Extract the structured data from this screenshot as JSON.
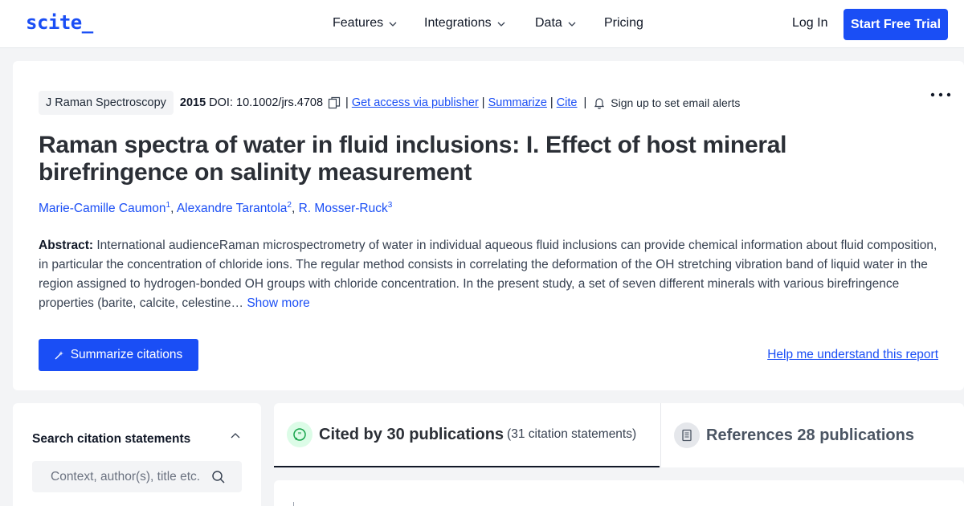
{
  "header": {
    "logo": "scite_",
    "nav": [
      {
        "label": "Features",
        "has_dropdown": true
      },
      {
        "label": "Integrations",
        "has_dropdown": true
      },
      {
        "label": "Data",
        "has_dropdown": true
      },
      {
        "label": "Pricing",
        "has_dropdown": false
      }
    ],
    "login_label": "Log In",
    "trial_label": "Start Free Trial"
  },
  "paper": {
    "journal": "J Raman Spectroscopy",
    "year": "2015",
    "doi": "DOI: 10.1002/jrs.4708",
    "links": {
      "access": "Get access via publisher",
      "summarize": "Summarize",
      "cite": "Cite"
    },
    "separator": "|",
    "alerts_label": "Sign up to set email alerts",
    "title": "Raman spectra of water in fluid inclusions: I. Effect of host mineral birefringence on salinity measurement",
    "authors": [
      {
        "name": "Marie-Camille Caumon",
        "affiliation": "1"
      },
      {
        "name": "Alexandre Tarantola",
        "affiliation": "2"
      },
      {
        "name": "R. Mosser-Ruck",
        "affiliation": "3"
      }
    ],
    "abstract_label": "Abstract:",
    "abstract_text": "International audienceRaman microspectrometry of water in individual aqueous fluid inclusions can provide chemical information about fluid composition, in particular the concentration of chloride ions. The regular method consists in correlating the deformation of the OH stretching vibration band of liquid water in the region assigned to hydrogen-bonded OH groups with chloride concentration. In the present study, a set of seven different minerals with various birefringence properties (barite, calcite, celestine…",
    "show_more": "Show more",
    "summarize_button": "Summarize citations",
    "help_link": "Help me understand this report"
  },
  "search": {
    "heading": "Search citation statements",
    "placeholder": "Context, author(s), title etc."
  },
  "tabs": {
    "cited_title": "Cited by 30 publications",
    "cited_sub": "(31 citation statements)",
    "refs_title": "References 28 publications"
  },
  "colors": {
    "brand_blue": "#1a4ef5",
    "cited_badge": "#dcfce7",
    "cited_icon": "#16a34a"
  },
  "icons": [
    "chevron-down-icon",
    "copy-icon",
    "bell-icon",
    "more-horizontal-icon",
    "sparkle-icon",
    "chevron-up-icon",
    "search-icon",
    "quote-bubble-icon",
    "document-icon"
  ]
}
